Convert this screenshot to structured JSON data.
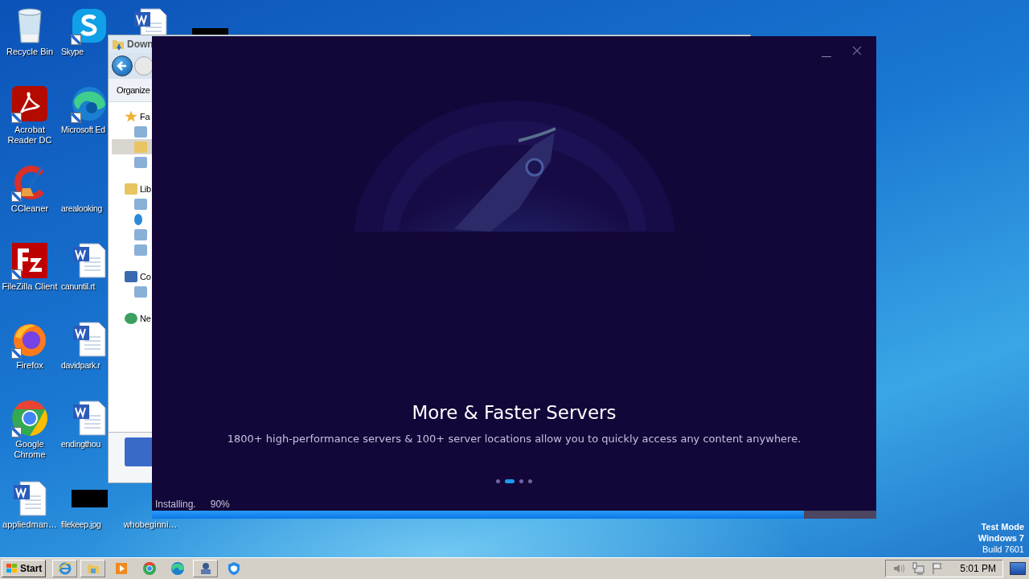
{
  "desktop": {
    "icons": [
      {
        "label": "Recycle Bin",
        "kind": "recycle"
      },
      {
        "label": "Acrobat\nReader DC",
        "kind": "acrobat"
      },
      {
        "label": "CCleaner",
        "kind": "ccleaner"
      },
      {
        "label": "FileZilla Client",
        "kind": "filezilla"
      },
      {
        "label": "Firefox",
        "kind": "firefox"
      },
      {
        "label": "Google\nChrome",
        "kind": "chrome"
      },
      {
        "label": "appliedman…",
        "kind": "word"
      },
      {
        "label": "Skype",
        "kind": "skype"
      },
      {
        "label": "Microsoft Ed",
        "kind": "edge"
      },
      {
        "label": "arealooking",
        "kind": "none"
      },
      {
        "label": "canuntil.rt",
        "kind": "word"
      },
      {
        "label": "davidpark.r",
        "kind": "word"
      },
      {
        "label": "endingthou",
        "kind": "word"
      },
      {
        "label": "filekeep.jpg",
        "kind": "image"
      },
      {
        "kind": "word"
      },
      {
        "label": "whobeginni…",
        "kind": "none"
      },
      {
        "kind": "image"
      }
    ],
    "notice": [
      "Test Mode",
      "Windows 7",
      "Build 7601"
    ]
  },
  "explorer": {
    "title": "Down",
    "toolbar": "Organize",
    "nav": [
      {
        "label": "Fa",
        "kind": "favorites",
        "children": [
          {
            "kind": "desktop",
            "selected": false
          },
          {
            "kind": "downloads",
            "selected": true
          },
          {
            "kind": "recent",
            "selected": false
          }
        ]
      },
      {
        "label": "Lib",
        "kind": "libraries",
        "children": [
          {
            "kind": "documents",
            "selected": false
          },
          {
            "kind": "music",
            "selected": false
          },
          {
            "kind": "pictures",
            "selected": false
          },
          {
            "kind": "videos",
            "selected": false
          }
        ]
      },
      {
        "label": "Co",
        "kind": "computer",
        "children": [
          {
            "kind": "drive",
            "selected": false
          }
        ]
      },
      {
        "label": "Ne",
        "kind": "network"
      }
    ]
  },
  "installer": {
    "title": "More & Faster Servers",
    "subtitle": "1800+ high-performance servers & 100+ server locations allow you to quickly access any content anywhere.",
    "slides": [
      {
        "selected": false
      },
      {
        "selected": true
      },
      {
        "selected": false
      },
      {
        "selected": false
      }
    ],
    "status": "Installing.",
    "percent": "90%",
    "level": 0.9
  },
  "taskbar": {
    "start": "Start",
    "apps": [
      {
        "kind": "ie"
      },
      {
        "kind": "folder"
      },
      {
        "kind": "media"
      },
      {
        "kind": "chrome"
      },
      {
        "kind": "edge"
      },
      {
        "kind": "app"
      },
      {
        "kind": "shield"
      }
    ],
    "tray": [
      {
        "kind": "speaker"
      },
      {
        "kind": "network"
      },
      {
        "kind": "flag"
      }
    ],
    "clock": "5:01 PM"
  }
}
